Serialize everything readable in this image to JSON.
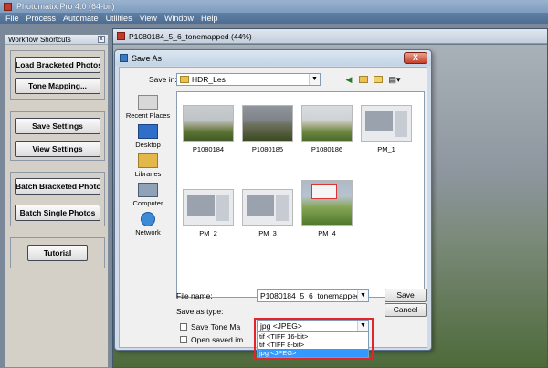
{
  "app": {
    "title": "Photomatix Pro 4.0 (64-bit)",
    "menu": [
      "File",
      "Process",
      "Automate",
      "Utilities",
      "View",
      "Window",
      "Help"
    ]
  },
  "workflow": {
    "title": "Workflow Shortcuts",
    "close_label": "x",
    "buttons": {
      "load": "Load Bracketed Photos",
      "tone": "Tone Mapping...",
      "save_settings": "Save Settings",
      "view_settings": "View Settings",
      "batch_bracketed": "Batch Bracketed Photos",
      "batch_single": "Batch Single Photos",
      "tutorial": "Tutorial"
    }
  },
  "document": {
    "title": "P1080184_5_6_tonemapped (44%)"
  },
  "dialog": {
    "title": "Save As",
    "close_label": "X",
    "save_in_label": "Save in:",
    "save_in_value": "HDR_Les",
    "places": [
      "Recent Places",
      "Desktop",
      "Libraries",
      "Computer",
      "Network"
    ],
    "files": [
      {
        "name": "P1080184",
        "kind": "photo"
      },
      {
        "name": "P1080185",
        "kind": "photo2"
      },
      {
        "name": "P1080186",
        "kind": "photo3"
      },
      {
        "name": "PM_1",
        "kind": "shot"
      },
      {
        "name": "PM_2",
        "kind": "shot"
      },
      {
        "name": "PM_3",
        "kind": "shot"
      },
      {
        "name": "PM_4",
        "kind": "tree"
      }
    ],
    "file_name_label": "File name:",
    "file_name_value": "P1080184_5_6_tonemapped",
    "save_type_label": "Save as type:",
    "save_type_value": "jpg <JPEG>",
    "type_options": [
      "tif <TIFF 16-bit>",
      "tif <TIFF 8-bit>",
      "jpg <JPEG>"
    ],
    "selected_type_index": 2,
    "save_button": "Save",
    "cancel_button": "Cancel",
    "save_tone_label": "Save Tone Ma",
    "open_saved_label": "Open saved im",
    "highlight_color": "#e0262a",
    "accent_color": "#3399ff"
  }
}
